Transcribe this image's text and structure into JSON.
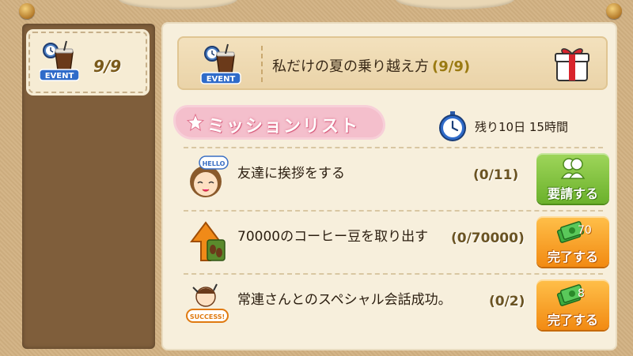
{
  "sidebar": {
    "event_tab": {
      "icon": "iced-coffee-event-icon",
      "badge": "EVENT",
      "count": "9/9"
    }
  },
  "header": {
    "title": "私だけの夏の乗り越え方",
    "progress": "(9/9)",
    "badge": "EVENT",
    "gift_icon": "gift-box-icon"
  },
  "missions": {
    "heading": "ミッションリスト",
    "timer": {
      "icon": "stopwatch-icon",
      "text": "残り10日 15時間"
    },
    "items": [
      {
        "icon": "hello-girl-icon",
        "icon_text": "HELLO",
        "name": "友達に挨拶をする",
        "progress": "(0/11)",
        "button": {
          "label": "要請する",
          "reward": "",
          "style": "green",
          "icon": "friends-icon"
        }
      },
      {
        "icon": "coffee-beans-up-arrow-icon",
        "name": "70000のコーヒー豆を取り出す",
        "progress": "(0/70000)",
        "button": {
          "label": "完了する",
          "reward": "70",
          "style": "orange",
          "icon": "cash-icon"
        }
      },
      {
        "icon": "success-icon",
        "icon_text": "SUCCESS!",
        "name": "常連さんとのスペシャル会話成功。",
        "progress": "(0/2)",
        "button": {
          "label": "完了する",
          "reward": "8",
          "style": "orange",
          "icon": "cash-icon"
        }
      }
    ]
  },
  "colors": {
    "frame": "#d2b182",
    "left_panel": "#7f5e3b",
    "right_panel": "#f7efdc",
    "green_button": "#6bb12b",
    "orange_button": "#f28a12",
    "heading_pink": "#f4bfcc"
  }
}
